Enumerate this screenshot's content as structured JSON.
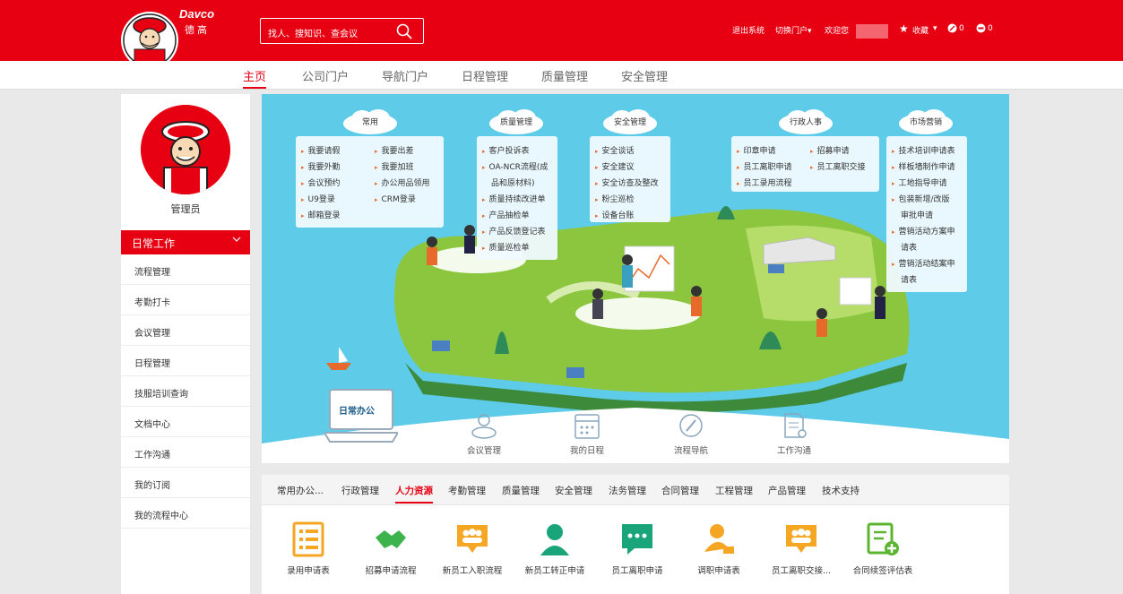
{
  "header": {
    "brand_en": "Davco",
    "brand_cn": "德高",
    "search_placeholder": "找人、搜知识、查会议",
    "logout": "退出系统",
    "switch_portal": "切换门户▾",
    "welcome": "欢迎您",
    "favorites": "收藏",
    "favorites_arrow": "▾",
    "msg_count": "0",
    "notice_count": "0"
  },
  "topnav": [
    "主页",
    "公司门户",
    "导航门户",
    "日程管理",
    "质量管理",
    "安全管理"
  ],
  "sidebar": {
    "role": "管理员",
    "section": "日常工作",
    "items": [
      "流程管理",
      "考勤打卡",
      "会议管理",
      "日程管理",
      "技服培训查询",
      "文档中心",
      "工作沟通",
      "我的订阅",
      "我的流程中心"
    ]
  },
  "banner": {
    "groups": [
      {
        "title": "常用",
        "items": [
          "我要请假",
          "我要出差",
          "我要外勤",
          "我要加班",
          "会议预约",
          "办公用品领用",
          "U9登录",
          "CRM登录",
          "邮箱登录"
        ]
      },
      {
        "title": "质量管理",
        "items": [
          "客户投诉表",
          "OA-NCR流程(成",
          "品和原材料)",
          "质量持续改进单",
          "产品抽检单",
          "产品反馈登记表",
          "质量巡检单"
        ]
      },
      {
        "title": "安全管理",
        "items": [
          "安全谈话",
          "安全建议",
          "安全访查及整改",
          "粉尘巡检",
          "设备台账"
        ]
      },
      {
        "title": "行政人事",
        "items": [
          "印章申请",
          "招募申请",
          "员工离职申请",
          "员工离职交接",
          "员工录用流程"
        ]
      },
      {
        "title": "市场营销",
        "items": [
          "技术培训申请表",
          "样板墙制作申请",
          "工地指导申请",
          "包装新增/改版",
          "审批申请",
          "营销活动方案申",
          "请表",
          "营销活动结案申",
          "请表"
        ]
      }
    ],
    "office_title": "日常办公",
    "office_items": [
      "会议管理",
      "我的日程",
      "流程导航",
      "工作沟通"
    ]
  },
  "tabs": [
    "常用办公...",
    "行政管理",
    "人力资源",
    "考勤管理",
    "质量管理",
    "安全管理",
    "法务管理",
    "合同管理",
    "工程管理",
    "产品管理",
    "技术支持"
  ],
  "apps": [
    {
      "label": "录用申请表",
      "icon": "list-icon",
      "color": "#f5a623"
    },
    {
      "label": "招募申请流程",
      "icon": "handshake-icon",
      "color": "#3cb44b"
    },
    {
      "label": "新员工入职流程",
      "icon": "group-chat-icon",
      "color": "#f5a623"
    },
    {
      "label": "新员工转正申请",
      "icon": "user-icon",
      "color": "#1aa47a"
    },
    {
      "label": "员工离职申请",
      "icon": "chat-icon",
      "color": "#1aa47a"
    },
    {
      "label": "调职申请表",
      "icon": "user-transfer-icon",
      "color": "#f5a623"
    },
    {
      "label": "员工离职交接...",
      "icon": "group-chat-icon",
      "color": "#f5a623"
    },
    {
      "label": "合同续签评估表",
      "icon": "contract-add-icon",
      "color": "#5cb531"
    }
  ]
}
